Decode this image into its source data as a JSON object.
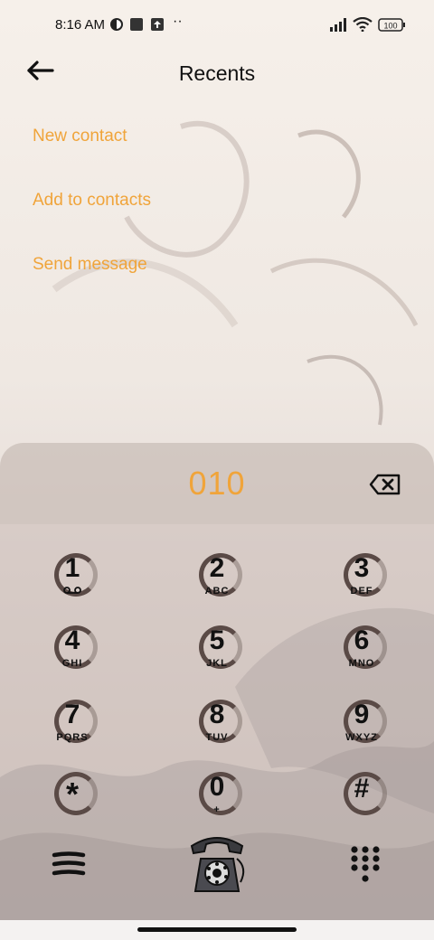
{
  "status_bar": {
    "time": "8:16 AM",
    "battery": "100"
  },
  "header": {
    "title": "Recents"
  },
  "menu": {
    "items": [
      {
        "label": "New contact"
      },
      {
        "label": "Add to contacts"
      },
      {
        "label": "Send message"
      }
    ]
  },
  "dialer": {
    "number": "010",
    "keys": [
      {
        "digit": "1",
        "letters": ""
      },
      {
        "digit": "2",
        "letters": "ABC"
      },
      {
        "digit": "3",
        "letters": "DEF"
      },
      {
        "digit": "4",
        "letters": "GHI"
      },
      {
        "digit": "5",
        "letters": "JKL"
      },
      {
        "digit": "6",
        "letters": "MNO"
      },
      {
        "digit": "7",
        "letters": "PQRS"
      },
      {
        "digit": "8",
        "letters": "TUV"
      },
      {
        "digit": "9",
        "letters": "WXYZ"
      },
      {
        "digit": "*",
        "letters": ""
      },
      {
        "digit": "0",
        "letters": "+"
      },
      {
        "digit": "#",
        "letters": ""
      }
    ]
  },
  "colors": {
    "accent": "#f0a43a"
  },
  "icons": {
    "back": "arrow-left-icon",
    "backspace": "backspace-icon",
    "menu": "hamburger-icon",
    "call": "rotary-phone-icon",
    "keypad": "keypad-icon"
  }
}
